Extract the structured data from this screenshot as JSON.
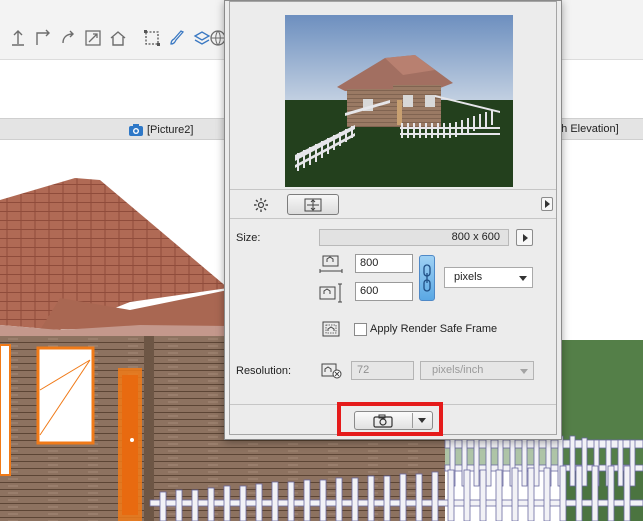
{
  "app": {
    "toolbar_icons": [
      "elevation-arrow-icon",
      "corner-arrow-icon",
      "rotate-icon",
      "resize-box-icon",
      "home-icon",
      "marquee-icon",
      "brush-icon",
      "layer-icon",
      "globe-icon"
    ],
    "tabs": {
      "picture_tab_label": "[Picture2]",
      "elevation_tab_label": "uth Elevation]",
      "dash_marker": "----"
    },
    "viewport_scene": "3d-house-model"
  },
  "dialog": {
    "preview_image": "rendered-house-preview",
    "toolbar": {
      "settings_icon": "gear-icon",
      "resize_icon": "fit-frame-icon",
      "more_icon": "right-triangle-icon"
    },
    "size": {
      "label": "Size:",
      "display": "800 x 600",
      "width_value": "800",
      "height_value": "600",
      "unit": "pixels"
    },
    "render_safe_frame": {
      "label": "Apply Render Safe Frame",
      "checked": false
    },
    "resolution": {
      "label": "Resolution:",
      "value": "72",
      "unit": "pixels/inch",
      "enabled": false
    },
    "capture": {
      "icon": "camera-icon",
      "highlight_color": "#e51b1b"
    }
  }
}
